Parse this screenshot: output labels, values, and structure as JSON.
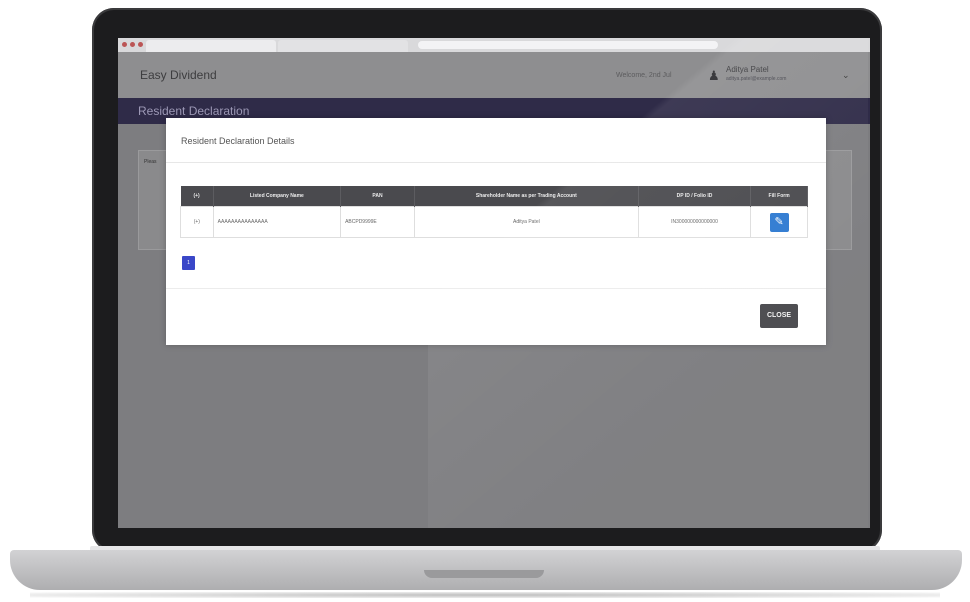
{
  "app": {
    "brand": "Easy Dividend",
    "header_sub": "Welcome, 2nd Jul",
    "user_name": "Aditya Patel",
    "user_email": "aditya.patel@example.com"
  },
  "page": {
    "title": "Resident Declaration",
    "card_label": "Pleas"
  },
  "modal": {
    "title": "Resident Declaration Details",
    "columns": [
      "(+)",
      "Listed Company Name",
      "PAN",
      "Shareholder Name as per Trading Account",
      "DP ID / Folio ID",
      "Fill Form"
    ],
    "rows": [
      {
        "expand": "(+)",
        "company": "AAAAAAAAAAAAAAA",
        "pan": "ABCPD9999E",
        "shareholder": "Aditya Patel",
        "dp_id": "IN300000000000000"
      }
    ],
    "page_number": "1",
    "close_label": "CLOSE"
  },
  "icons": {
    "edit": "pencil-icon",
    "user": "user-icon"
  },
  "colors": {
    "title_bar": "#2f2b48",
    "primary": "#2e7ad1",
    "page_active": "#3a47c8",
    "table_header": "#4a4a4e"
  }
}
